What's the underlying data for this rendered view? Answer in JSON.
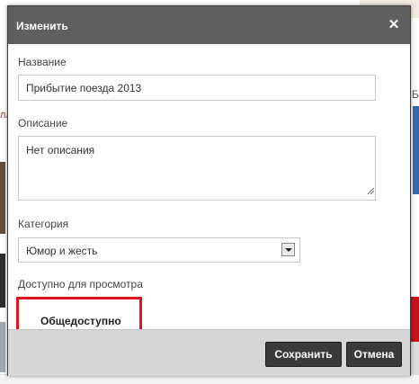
{
  "background": {
    "right_char": "Б",
    "left_char": "лл"
  },
  "dialog": {
    "title": "Изменить",
    "close_glyph": "✕",
    "name": {
      "label": "Название",
      "value": "Прибытие поезда 2013"
    },
    "description": {
      "label": "Описание",
      "value": "Нет описания"
    },
    "category": {
      "label": "Категория",
      "selected": "Юмор и жесть"
    },
    "privacy": {
      "label": "Доступно для просмотра",
      "selected": "Общедоступно",
      "highlight_color": "#e0121b"
    },
    "buttons": {
      "save": "Сохранить",
      "cancel": "Отмена"
    }
  }
}
